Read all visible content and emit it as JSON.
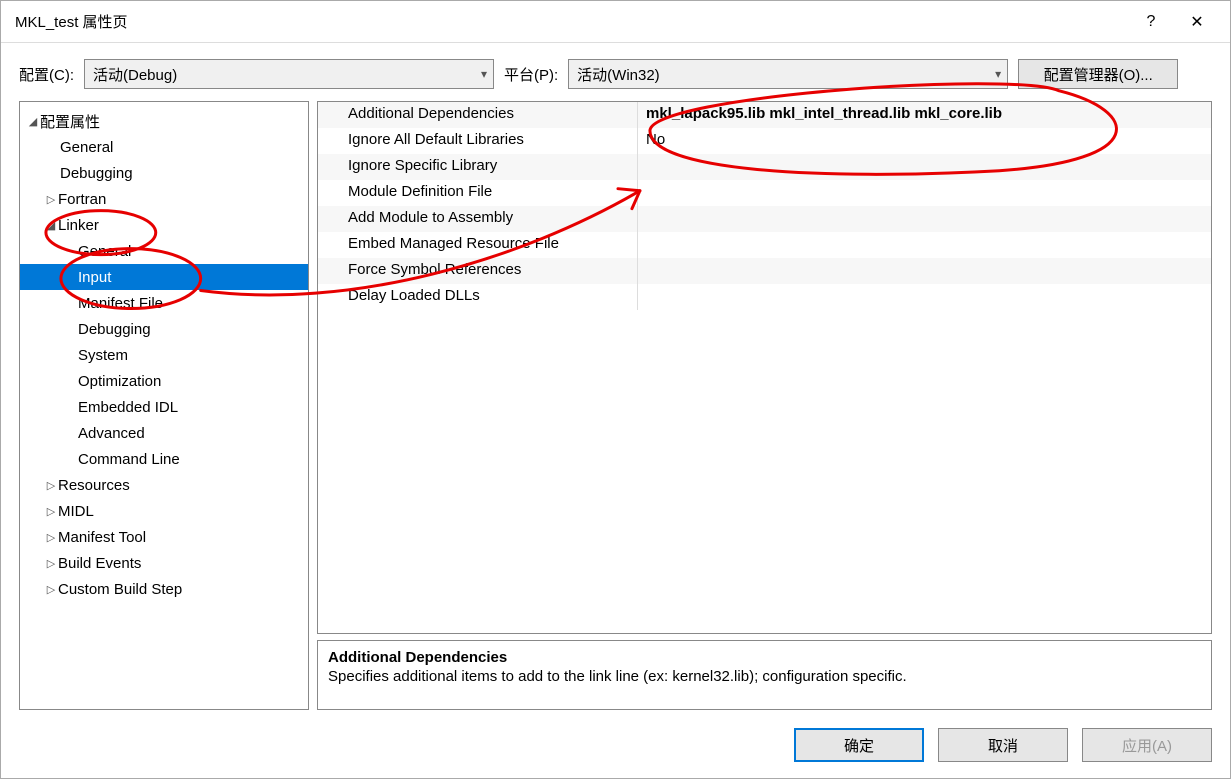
{
  "window": {
    "title": "MKL_test 属性页",
    "help_icon": "?",
    "close_icon": "✕"
  },
  "toolbar": {
    "config_label": "配置(C):",
    "config_value": "活动(Debug)",
    "platform_label": "平台(P):",
    "platform_value": "活动(Win32)",
    "config_manager_label": "配置管理器(O)..."
  },
  "tree": {
    "root": "配置属性",
    "general": "General",
    "debugging": "Debugging",
    "fortran": "Fortran",
    "linker": "Linker",
    "linker_general": "General",
    "linker_input": "Input",
    "linker_manifest_file": "Manifest File",
    "linker_debugging": "Debugging",
    "linker_system": "System",
    "linker_optimization": "Optimization",
    "linker_embedded_idl": "Embedded IDL",
    "linker_advanced": "Advanced",
    "linker_command_line": "Command Line",
    "resources": "Resources",
    "midl": "MIDL",
    "manifest_tool": "Manifest Tool",
    "build_events": "Build Events",
    "custom_build_step": "Custom Build Step"
  },
  "grid": {
    "rows": [
      {
        "label": "Additional Dependencies",
        "value": "mkl_lapack95.lib mkl_intel_thread.lib mkl_core.lib",
        "bold": true
      },
      {
        "label": "Ignore All Default Libraries",
        "value": "No"
      },
      {
        "label": "Ignore Specific Library",
        "value": ""
      },
      {
        "label": "Module Definition File",
        "value": ""
      },
      {
        "label": "Add Module to Assembly",
        "value": ""
      },
      {
        "label": "Embed Managed Resource File",
        "value": ""
      },
      {
        "label": "Force Symbol References",
        "value": ""
      },
      {
        "label": "Delay Loaded DLLs",
        "value": ""
      }
    ]
  },
  "description": {
    "title": "Additional Dependencies",
    "body": "Specifies additional items to add to the link line (ex: kernel32.lib); configuration specific."
  },
  "buttons": {
    "ok": "确定",
    "cancel": "取消",
    "apply": "应用(A)"
  }
}
